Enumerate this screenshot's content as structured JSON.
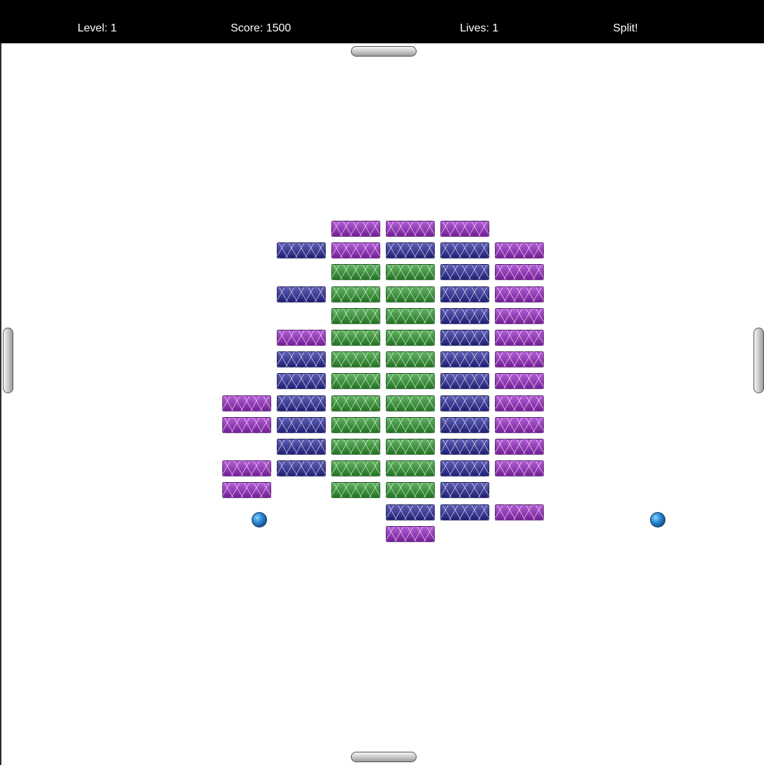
{
  "hud": {
    "level": "Level: 1",
    "score": "Score: 1500",
    "lives": "Lives: 1",
    "status": "Split!"
  },
  "colors": {
    "hud_background": "#000000",
    "hud_text": "#ffffff",
    "playfield_background": "#ffffff",
    "brick_purple": "#9a28c8",
    "brick_blue": "#2a2a9e",
    "brick_green": "#2e9a2e",
    "paddle": "#c8c8c8",
    "ball": "#2f8fd8"
  },
  "bricks": {
    "columns": 6,
    "rows": 15,
    "grid": [
      [
        null,
        null,
        "purple",
        "purple",
        "purple",
        null
      ],
      [
        null,
        "blue",
        "purple",
        "blue",
        "blue",
        "purple"
      ],
      [
        null,
        null,
        "green",
        "green",
        "blue",
        "purple"
      ],
      [
        null,
        "blue",
        "green",
        "green",
        "blue",
        "purple"
      ],
      [
        null,
        null,
        "green",
        "green",
        "blue",
        "purple"
      ],
      [
        null,
        "purple",
        "green",
        "green",
        "blue",
        "purple"
      ],
      [
        null,
        "blue",
        "green",
        "green",
        "blue",
        "purple"
      ],
      [
        null,
        "blue",
        "green",
        "green",
        "blue",
        "purple"
      ],
      [
        "purple",
        "blue",
        "green",
        "green",
        "blue",
        "purple"
      ],
      [
        "purple",
        "blue",
        "green",
        "green",
        "blue",
        "purple"
      ],
      [
        null,
        "blue",
        "green",
        "green",
        "blue",
        "purple"
      ],
      [
        "purple",
        "blue",
        "green",
        "green",
        "blue",
        "purple"
      ],
      [
        "purple",
        null,
        "green",
        "green",
        "blue",
        null
      ],
      [
        null,
        null,
        null,
        "blue",
        "blue",
        "purple"
      ],
      [
        null,
        null,
        null,
        "purple",
        null,
        null
      ]
    ]
  },
  "paddles": {
    "top": "paddle-horizontal",
    "bottom": "paddle-horizontal",
    "left": "paddle-vertical",
    "right": "paddle-vertical"
  },
  "balls": [
    "ball",
    "ball"
  ]
}
